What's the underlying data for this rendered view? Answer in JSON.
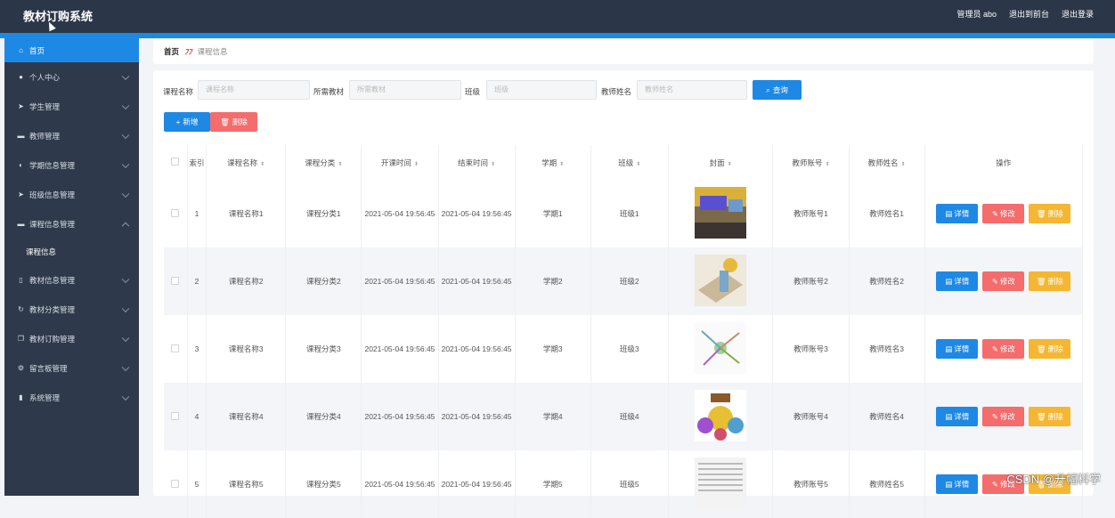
{
  "app": {
    "title": "教材订购系统"
  },
  "topbar": {
    "user": "管理员 abo",
    "front": "退出到前台",
    "logout": "退出登录"
  },
  "sidebar": {
    "home": "首页",
    "items": [
      {
        "label": "个人中心",
        "icon": "person-icon"
      },
      {
        "label": "学生管理",
        "icon": "send-icon"
      },
      {
        "label": "教师管理",
        "icon": "monitor-icon"
      },
      {
        "label": "学期信息管理",
        "icon": "mic-icon"
      },
      {
        "label": "班级信息管理",
        "icon": "send-icon"
      },
      {
        "label": "课程信息管理",
        "icon": "monitor-icon"
      },
      {
        "label": "教材信息管理",
        "icon": "badge-icon"
      },
      {
        "label": "教材分类管理",
        "icon": "refresh-icon"
      },
      {
        "label": "教材订购管理",
        "icon": "copy-icon"
      },
      {
        "label": "留言板管理",
        "icon": "gear-icon"
      },
      {
        "label": "系统管理",
        "icon": "bar-chart-icon"
      }
    ],
    "sub_item": "课程信息"
  },
  "breadcrumb": {
    "home": "首页",
    "current": "课程信息"
  },
  "search": {
    "course_name_label": "课程名称",
    "course_name_placeholder": "课程名称",
    "textbook_label": "所需教材",
    "textbook_placeholder": "所需教材",
    "class_label": "班级",
    "class_placeholder": "班级",
    "teacher_label": "教师姓名",
    "teacher_placeholder": "教师姓名",
    "query_button": "查询"
  },
  "toolbar": {
    "add": "新增",
    "delete": "删除"
  },
  "table": {
    "headers": [
      "索引",
      "课程名称",
      "课程分类",
      "开课时间",
      "结束时间",
      "学期",
      "班级",
      "封面",
      "教师账号",
      "教师姓名",
      "操作"
    ],
    "rows": [
      {
        "index": "1",
        "name": "课程名称1",
        "category": "课程分类1",
        "start": "2021-05-04 19:56:45",
        "end": "2021-05-04 19:56:45",
        "term": "学期1",
        "class": "班级1",
        "teacher_account": "教师账号1",
        "teacher_name": "教师姓名1"
      },
      {
        "index": "2",
        "name": "课程名称2",
        "category": "课程分类2",
        "start": "2021-05-04 19:56:45",
        "end": "2021-05-04 19:56:45",
        "term": "学期2",
        "class": "班级2",
        "teacher_account": "教师账号2",
        "teacher_name": "教师姓名2"
      },
      {
        "index": "3",
        "name": "课程名称3",
        "category": "课程分类3",
        "start": "2021-05-04 19:56:45",
        "end": "2021-05-04 19:56:45",
        "term": "学期3",
        "class": "班级3",
        "teacher_account": "教师账号3",
        "teacher_name": "教师姓名3"
      },
      {
        "index": "4",
        "name": "课程名称4",
        "category": "课程分类4",
        "start": "2021-05-04 19:56:45",
        "end": "2021-05-04 19:56:45",
        "term": "学期4",
        "class": "班级4",
        "teacher_account": "教师账号4",
        "teacher_name": "教师姓名4"
      },
      {
        "index": "5",
        "name": "课程名称5",
        "category": "课程分类5",
        "start": "2021-05-04 19:56:45",
        "end": "2021-05-04 19:56:45",
        "term": "学期5",
        "class": "班级5",
        "teacher_account": "教师账号5",
        "teacher_name": "教师姓名5"
      }
    ],
    "actions": {
      "detail": "详情",
      "edit": "修改",
      "delete": "删除"
    }
  },
  "watermark": "CSDN @升幅科学",
  "colors": {
    "topbar": "#2b3748",
    "accent": "#1e88e5",
    "danger": "#f56c6c",
    "warning": "#f5b731",
    "sidebar": "#2e3a4b"
  }
}
